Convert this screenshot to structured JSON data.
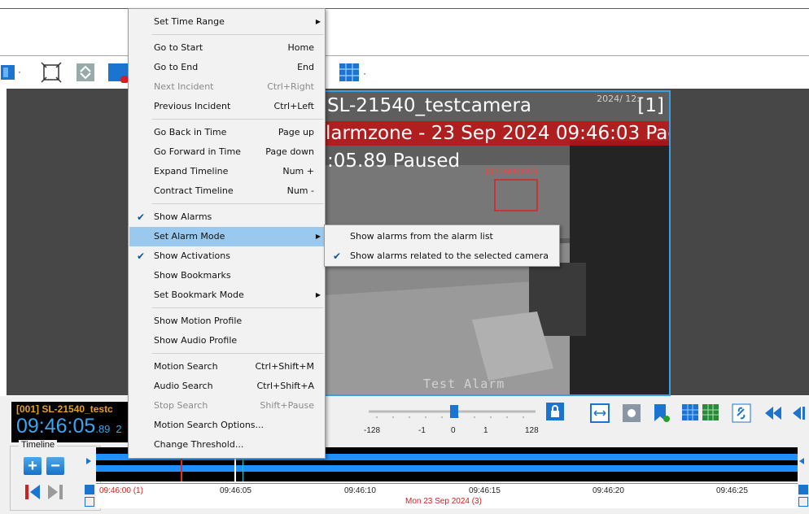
{
  "menu": {
    "items": [
      {
        "label": "Set Time Range",
        "shortcut": "",
        "submenu": true
      },
      {
        "label": "Go to Start",
        "shortcut": "Home"
      },
      {
        "label": "Go to End",
        "shortcut": "End"
      },
      {
        "label": "Next Incident",
        "shortcut": "Ctrl+Right",
        "disabled": true
      },
      {
        "label": "Previous Incident",
        "shortcut": "Ctrl+Left"
      },
      {
        "label": "Go Back in Time",
        "shortcut": "Page up"
      },
      {
        "label": "Go Forward in Time",
        "shortcut": "Page down"
      },
      {
        "label": "Expand Timeline",
        "shortcut": "Num +"
      },
      {
        "label": "Contract Timeline",
        "shortcut": "Num -"
      },
      {
        "label": "Show Alarms",
        "checked": true
      },
      {
        "label": "Set Alarm Mode",
        "submenu": true,
        "highlighted": true
      },
      {
        "label": "Show Activations",
        "checked": true
      },
      {
        "label": "Show Bookmarks"
      },
      {
        "label": "Set Bookmark Mode",
        "submenu": true
      },
      {
        "label": "Show Motion Profile"
      },
      {
        "label": "Show Audio Profile"
      },
      {
        "label": "Motion Search",
        "shortcut": "Ctrl+Shift+M"
      },
      {
        "label": "Audio Search",
        "shortcut": "Ctrl+Shift+A"
      },
      {
        "label": "Stop Search",
        "shortcut": "Shift+Pause",
        "disabled": true
      },
      {
        "label": "Motion Search Options..."
      },
      {
        "label": "Change Threshold..."
      }
    ]
  },
  "submenu": {
    "items": [
      {
        "label": "Show alarms from the alarm list",
        "checked": false
      },
      {
        "label": "Show alarms related to the selected camera",
        "checked": true
      }
    ]
  },
  "video": {
    "camera_title": "SL-21540_testcamera",
    "camera_number": "[1]",
    "date_corner": "2024/ 12:",
    "alarm_banner": "larmzone - 23 Sep 2024 09:46:03 Pac",
    "time_status": ":05.89 Paused",
    "box_label": "[1111491027]",
    "watermark": "Test Alarm"
  },
  "camera_label": {
    "name": "[001] SL-21540_testc",
    "time_main": "09:46:05",
    "time_fraction": ".89",
    "time_suffix": "2"
  },
  "timeline": {
    "group_label": "Timeline",
    "speed_ticks": [
      "-128",
      "-1",
      "0",
      "1",
      "128"
    ],
    "scale_labels": [
      "09:46:00 (1)",
      "09:46:05",
      "09:46:10",
      "09:46:15",
      "09:46:20",
      "09:46:25"
    ],
    "date_label": "Mon 23 Sep 2024 (3)"
  },
  "colors": {
    "accent": "#1e90ff",
    "alarm_red": "#c81414",
    "menu_highlight": "#99c9ef",
    "time_blue": "#3aa6f0",
    "name_orange": "#e8a020"
  },
  "icons": [
    "layout-icon",
    "fit-icon",
    "swap-icon",
    "grid-close-icon",
    "grid-layout-icon",
    "plus-icon",
    "minus-icon",
    "prev-alarm-icon",
    "next-alarm-icon",
    "lock-icon",
    "fit-width-icon",
    "snapshot-icon",
    "bookmark-add-icon",
    "grid-icon",
    "link-icon",
    "rewind-icon",
    "step-back-icon"
  ]
}
